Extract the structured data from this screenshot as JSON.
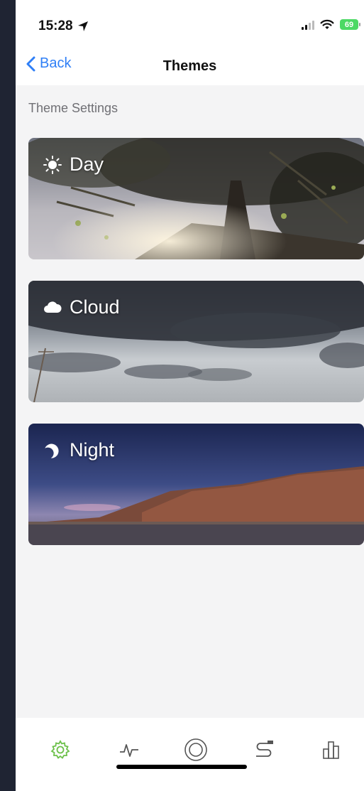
{
  "status_bar": {
    "time": "15:28",
    "battery": "69"
  },
  "nav": {
    "back_label": "Back",
    "title": "Themes"
  },
  "section": {
    "title": "Theme Settings"
  },
  "themes": [
    {
      "label": "Day",
      "icon": "sun-icon"
    },
    {
      "label": "Cloud",
      "icon": "cloud-icon"
    },
    {
      "label": "Night",
      "icon": "moon-icon"
    }
  ],
  "tab_bar": {
    "tabs": [
      {
        "name": "settings",
        "icon": "gear-icon",
        "active": true
      },
      {
        "name": "activity",
        "icon": "pulse-icon",
        "active": false
      },
      {
        "name": "record",
        "icon": "record-circle-icon",
        "active": false
      },
      {
        "name": "route",
        "icon": "route-icon",
        "active": false
      },
      {
        "name": "stats",
        "icon": "bar-chart-icon",
        "active": false
      }
    ],
    "active_color": "#6cc04a",
    "inactive_color": "#555555"
  },
  "colors": {
    "accent": "#2f7ff6",
    "battery": "#4cd964"
  }
}
